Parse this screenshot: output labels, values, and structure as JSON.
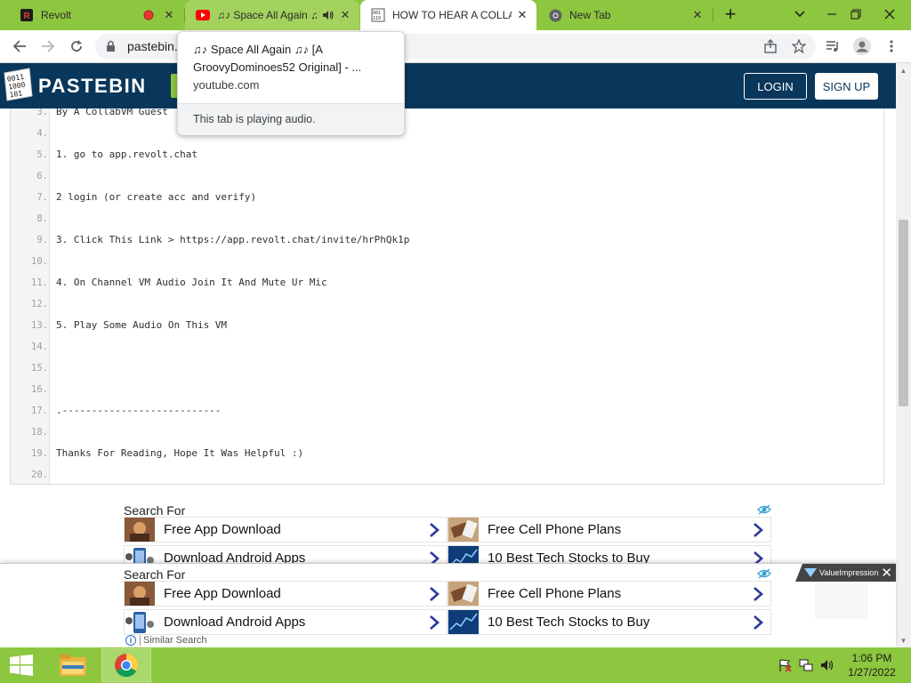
{
  "browser": {
    "tabs": [
      {
        "title": "Revolt",
        "state": "normal"
      },
      {
        "title": "♫♪ Space All Again ♫♪",
        "state": "hovered",
        "audio": true
      },
      {
        "title": "HOW TO HEAR A COLLA",
        "state": "active"
      },
      {
        "title": "New Tab",
        "state": "normal"
      }
    ],
    "new_tab_label": "+",
    "url": "pastebin.",
    "hovercard": {
      "title": "♫♪ Space All Again ♫♪ [A GroovyDominoes52 Original] - ...",
      "domain": "youtube.com",
      "footer": "This tab is playing audio."
    }
  },
  "pastebin": {
    "logo_text": "PASTEBIN",
    "login_label": "LOGIN",
    "signup_label": "SIGN UP"
  },
  "code_lines": [
    {
      "num": "3.",
      "text": "By A CollabVM Guest"
    },
    {
      "num": "4.",
      "text": ""
    },
    {
      "num": "5.",
      "text": "1. go to app.revolt.chat"
    },
    {
      "num": "6.",
      "text": ""
    },
    {
      "num": "7.",
      "text": "2 login (or create acc and verify)"
    },
    {
      "num": "8.",
      "text": ""
    },
    {
      "num": "9.",
      "text": "3. Click This Link > https://app.revolt.chat/invite/hrPhQk1p"
    },
    {
      "num": "10.",
      "text": ""
    },
    {
      "num": "11.",
      "text": "4. On Channel VM Audio Join It And Mute Ur Mic"
    },
    {
      "num": "12.",
      "text": ""
    },
    {
      "num": "13.",
      "text": "5. Play Some Audio On This VM"
    },
    {
      "num": "14.",
      "text": ""
    },
    {
      "num": "15.",
      "text": ""
    },
    {
      "num": "16.",
      "text": ""
    },
    {
      "num": "17.",
      "text": ".---------------------------"
    },
    {
      "num": "18.",
      "text": ""
    },
    {
      "num": "19.",
      "text": "Thanks For Reading, Hope It Was Helpful :)"
    },
    {
      "num": "20.",
      "text": ""
    }
  ],
  "ads": {
    "title": "Search For",
    "items": [
      {
        "label": "Free App Download"
      },
      {
        "label": "Free Cell Phone Plans"
      },
      {
        "label": "Download Android Apps"
      },
      {
        "label": "10 Best Tech Stocks to Buy"
      }
    ],
    "badge": "ValueImpression",
    "similar": "Similar Search"
  },
  "taskbar": {
    "time": "1:06 PM",
    "date": "1/27/2022"
  },
  "colors": {
    "chrome_frame": "#8dc63f",
    "pastebin_navy": "#09365b",
    "pastebin_green": "#8dc63f",
    "ad_arrow": "#2b3a9a"
  }
}
